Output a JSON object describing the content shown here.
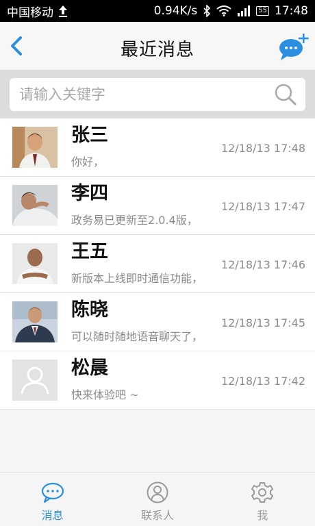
{
  "statusbar": {
    "carrier": "中国移动",
    "speed": "0.94K/s",
    "battery": "55",
    "time": "17:48"
  },
  "nav": {
    "title": "最近消息"
  },
  "search": {
    "placeholder": "请输入关键字"
  },
  "conversations": [
    {
      "name": "张三",
      "preview": "你好，",
      "time": "12/18/13 17:48"
    },
    {
      "name": "李四",
      "preview": "政务易已更新至2.0.4版，",
      "time": "12/18/13 17:47"
    },
    {
      "name": "王五",
      "preview": "新版本上线即时通信功能，",
      "time": "12/18/13 17:46"
    },
    {
      "name": "陈晓",
      "preview": "可以随时随地语音聊天了，",
      "time": "12/18/13 17:45"
    },
    {
      "name": "松晨",
      "preview": "快来体验吧 ~",
      "time": "12/18/13 17:42"
    }
  ],
  "tabs": [
    {
      "label": "消息",
      "icon": "chat-icon",
      "active": true
    },
    {
      "label": "联系人",
      "icon": "contacts-icon",
      "active": false
    },
    {
      "label": "我",
      "icon": "gear-icon",
      "active": false
    }
  ],
  "colors": {
    "accent": "#2a8fe0",
    "statusbar": "#000000",
    "search_bg": "#dcdcdc"
  }
}
